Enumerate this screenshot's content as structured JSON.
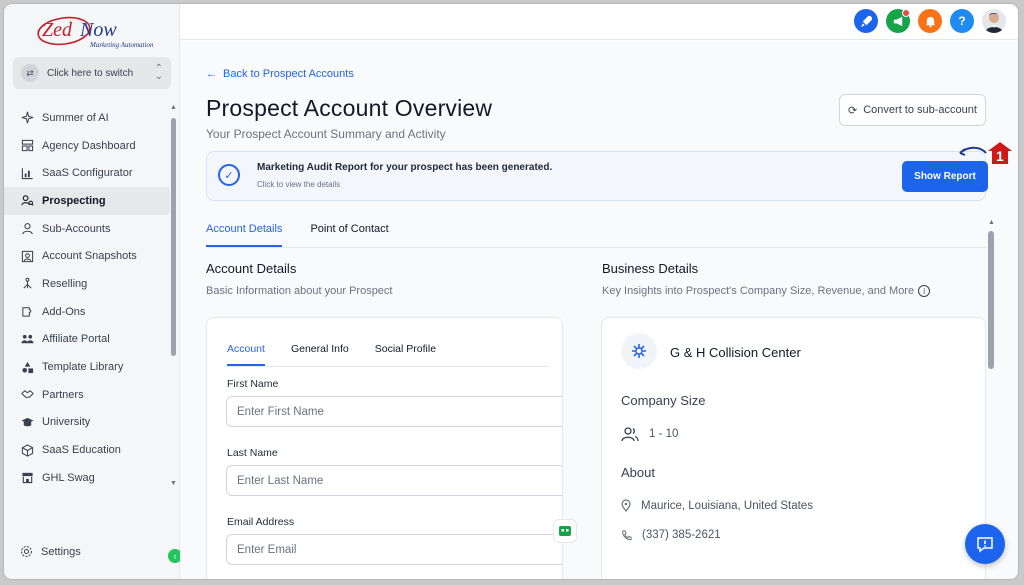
{
  "brand": {
    "name": "Zed Now",
    "tagline": "Marketing Automation"
  },
  "switcher": {
    "label": "Click here to switch"
  },
  "sidebar": {
    "items": [
      {
        "label": "Summer of AI",
        "icon": "sparkle-icon",
        "active": false
      },
      {
        "label": "Agency Dashboard",
        "icon": "dashboard-icon",
        "active": false
      },
      {
        "label": "SaaS Configurator",
        "icon": "chart-icon",
        "active": false
      },
      {
        "label": "Prospecting",
        "icon": "people-search-icon",
        "active": true
      },
      {
        "label": "Sub-Accounts",
        "icon": "user-icon",
        "active": false
      },
      {
        "label": "Account Snapshots",
        "icon": "snapshot-icon",
        "active": false
      },
      {
        "label": "Reselling",
        "icon": "reselling-icon",
        "active": false
      },
      {
        "label": "Add-Ons",
        "icon": "addons-icon",
        "active": false
      },
      {
        "label": "Affiliate Portal",
        "icon": "affiliate-icon",
        "active": false
      },
      {
        "label": "Template Library",
        "icon": "shapes-icon",
        "active": false
      },
      {
        "label": "Partners",
        "icon": "handshake-icon",
        "active": false
      },
      {
        "label": "University",
        "icon": "graduation-cap-icon",
        "active": false
      },
      {
        "label": "SaaS Education",
        "icon": "cube-icon",
        "active": false
      },
      {
        "label": "GHL Swag",
        "icon": "store-icon",
        "active": false
      }
    ],
    "settings_label": "Settings"
  },
  "topbar": {
    "icons": [
      {
        "name": "rocket-icon",
        "color": "#1d64ec"
      },
      {
        "name": "megaphone-icon",
        "color": "#16a34a"
      },
      {
        "name": "bell-icon",
        "color": "#f97316"
      },
      {
        "name": "help-icon",
        "color": "#1d8bf1",
        "glyph": "?"
      }
    ]
  },
  "main": {
    "back_label": "Back to Prospect Accounts",
    "title": "Prospect Account Overview",
    "subtitle": "Your Prospect Account Summary and Activity",
    "convert_label": "Convert to sub-account",
    "audit": {
      "title": "Marketing Audit Report for your prospect has been generated.",
      "subtitle": "Click to view the details",
      "button": "Show Report"
    },
    "annotation_number": "1",
    "tabs": [
      "Account Details",
      "Point of Contact"
    ],
    "account_details": {
      "title": "Account Details",
      "subtitle": "Basic Information about your Prospect",
      "inner_tabs": [
        "Account",
        "General Info",
        "Social Profile"
      ],
      "fields": [
        {
          "label": "First Name",
          "placeholder": "Enter First Name"
        },
        {
          "label": "Last Name",
          "placeholder": "Enter Last Name"
        },
        {
          "label": "Email Address",
          "placeholder": "Enter Email"
        }
      ]
    },
    "business_details": {
      "title": "Business Details",
      "subtitle": "Key Insights into Prospect's Company Size, Revenue, and More",
      "company_name": "G & H Collision Center",
      "company_size_label": "Company Size",
      "company_size": "1 - 10",
      "about_label": "About",
      "location": "Maurice, Louisiana, United States",
      "phone": "(337) 385-2621"
    }
  },
  "colors": {
    "accent": "#1d64ec",
    "annotation_red": "#d01818"
  }
}
